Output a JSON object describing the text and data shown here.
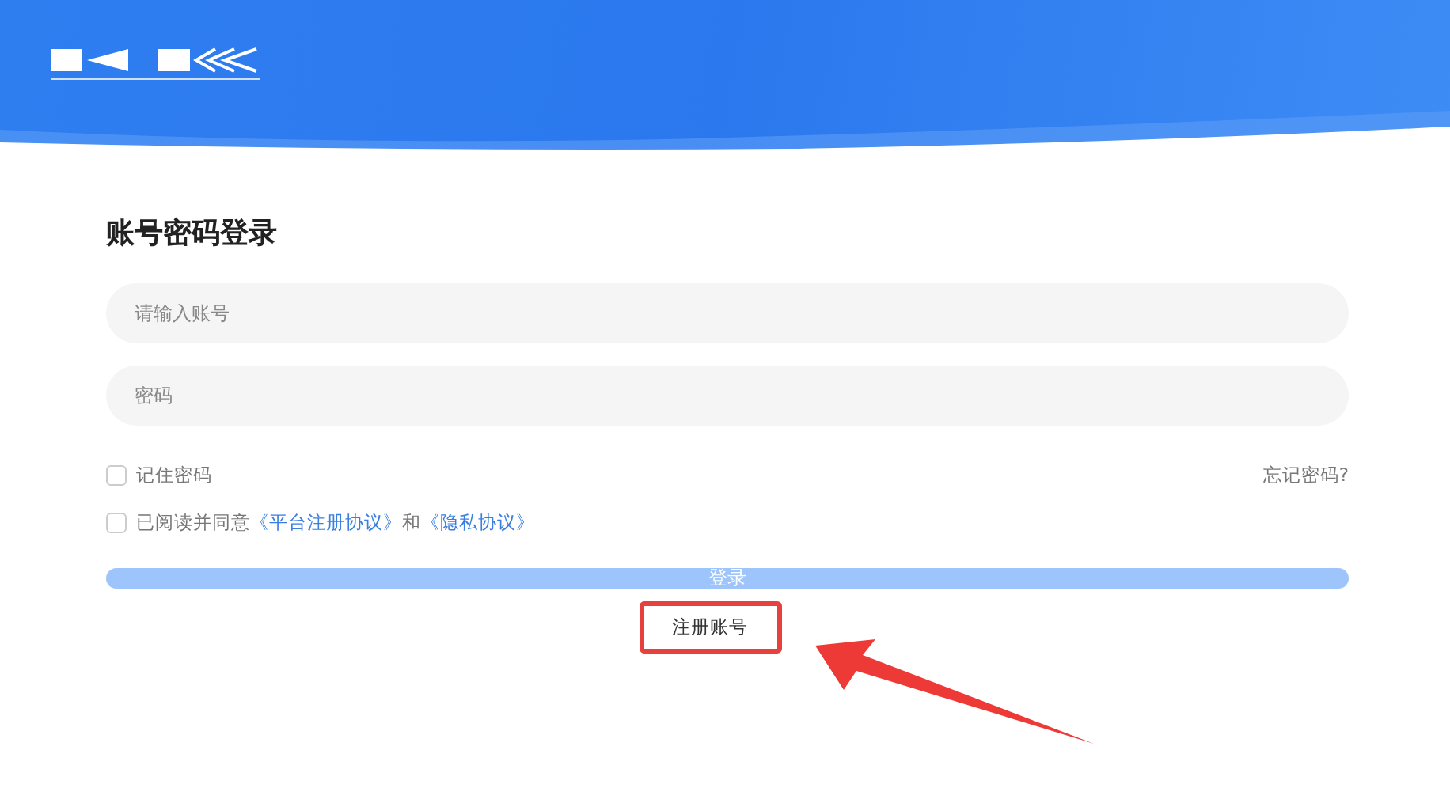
{
  "form": {
    "title": "账号密码登录",
    "fields": [
      {
        "placeholder": "请输入账号"
      },
      {
        "placeholder": "密码"
      }
    ],
    "remember": {
      "label": "记住密码",
      "checked": false
    },
    "forgot_link": "忘记密码?",
    "agreement": {
      "checked": false,
      "text": "已阅读并同意",
      "links": [
        "《平台注册协议》",
        "《隐私协议》"
      ],
      "joiner": "和"
    },
    "login_button": {
      "label": "登录",
      "disabled": true
    },
    "register_link": "注册账号"
  }
}
